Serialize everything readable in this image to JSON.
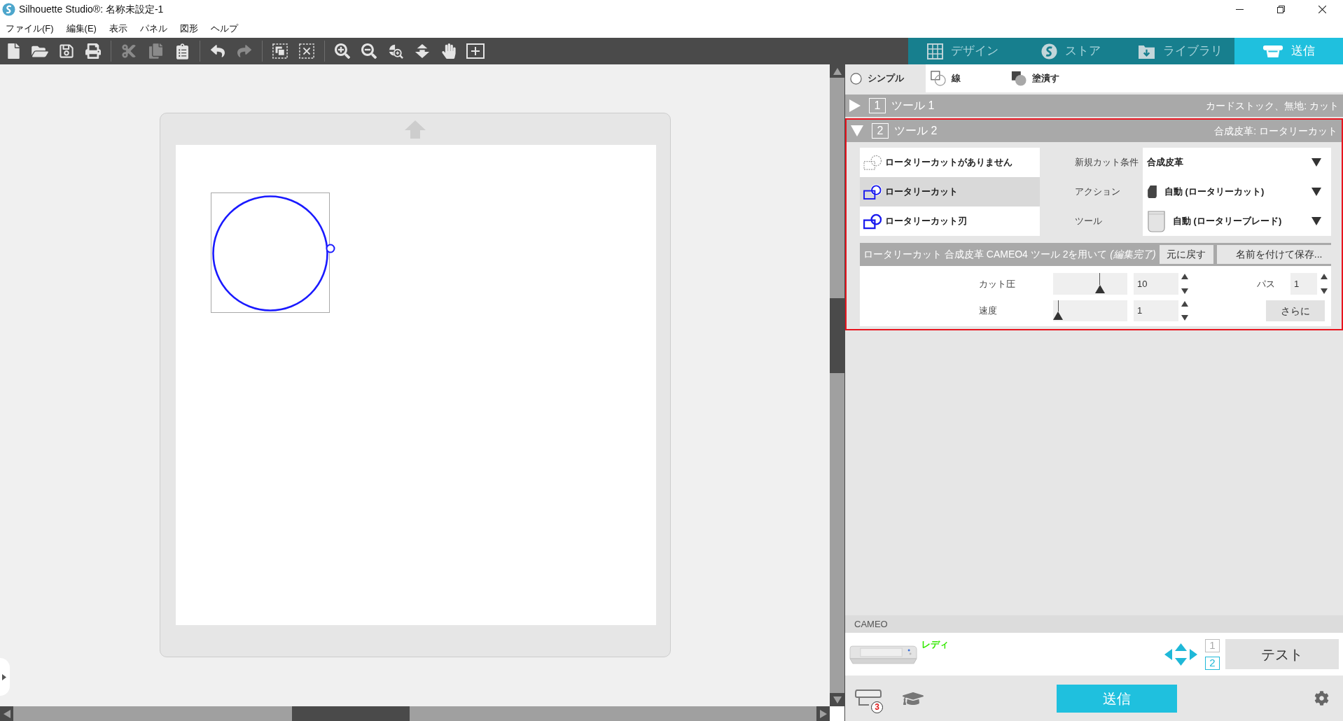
{
  "window": {
    "title": "Silhouette Studio®: 名称未設定-1"
  },
  "menu": [
    "ファイル(F)",
    "編集(E)",
    "表示",
    "パネル",
    "図形",
    "ヘルプ"
  ],
  "toolbar": [
    [
      {
        "disabled": false
      },
      {
        "disabled": false
      },
      {
        "disabled": false
      },
      {
        "disabled": false
      }
    ],
    [
      {
        "disabled": true
      },
      {
        "disabled": true
      },
      {
        "disabled": false
      }
    ],
    [
      {
        "disabled": false
      },
      {
        "disabled": true
      }
    ],
    [
      {
        "disabled": false
      },
      {
        "disabled": false
      }
    ],
    [
      {
        "disabled": false
      },
      {
        "disabled": false
      },
      {
        "disabled": false
      },
      {
        "disabled": false
      },
      {
        "disabled": false
      },
      {
        "disabled": false
      }
    ]
  ],
  "tabs": [
    {
      "label": "デザイン",
      "selected": false
    },
    {
      "label": "ストア",
      "selected": false
    },
    {
      "label": "ライブラリ",
      "selected": false
    },
    {
      "label": "送信",
      "selected": true
    }
  ],
  "modes": [
    {
      "kind": "simple",
      "label": "シンプル",
      "selected": true
    },
    {
      "kind": "line",
      "label": "線",
      "selected": false
    },
    {
      "kind": "fill",
      "label": "塗潰す",
      "selected": false
    }
  ],
  "tools": [
    {
      "number": "1",
      "label": "ツール 1",
      "summary": "カードストック、無地: カット",
      "expanded": false,
      "selected": false
    },
    {
      "number": "2",
      "label": "ツール 2",
      "summary": "合成皮革: ロータリーカット",
      "expanded": true,
      "selected": true,
      "cut_types": [
        {
          "kind": "none",
          "label": "ロータリーカットがありません",
          "selected": false
        },
        {
          "kind": "rotary",
          "label": "ロータリーカット",
          "selected": true
        },
        {
          "kind": "blade",
          "label": "ロータリーカット刃",
          "selected": false
        }
      ],
      "settings": [
        {
          "kind": "material",
          "label": "新規カット条件",
          "value": "合成皮革"
        },
        {
          "kind": "action",
          "label": "アクション",
          "value": "自動 (ロータリーカット)"
        },
        {
          "kind": "tool",
          "label": "ツール",
          "value": "自動 (ロータリーブレード)"
        }
      ],
      "status": "ロータリーカット 合成皮革 CAMEO4 ツール 2を用いて *(編集完了)*",
      "buttons": [
        "元に戻す",
        "名前を付けて保存..."
      ],
      "force": {
        "label": "カット圧",
        "value": "10",
        "level": 0.65
      },
      "speed": {
        "label": "速度",
        "value": "1",
        "level": 0
      },
      "passes": {
        "label": "パス",
        "value": "1"
      },
      "more_button": "さらに"
    }
  ],
  "device": {
    "name": "CAMEO",
    "status": "レディ",
    "tool_slots": [
      {
        "label": "1",
        "selected": false
      },
      {
        "label": "2",
        "selected": true
      }
    ],
    "test_button": "テスト"
  },
  "footer": {
    "queue_badge": "3",
    "send_button": "送信"
  }
}
